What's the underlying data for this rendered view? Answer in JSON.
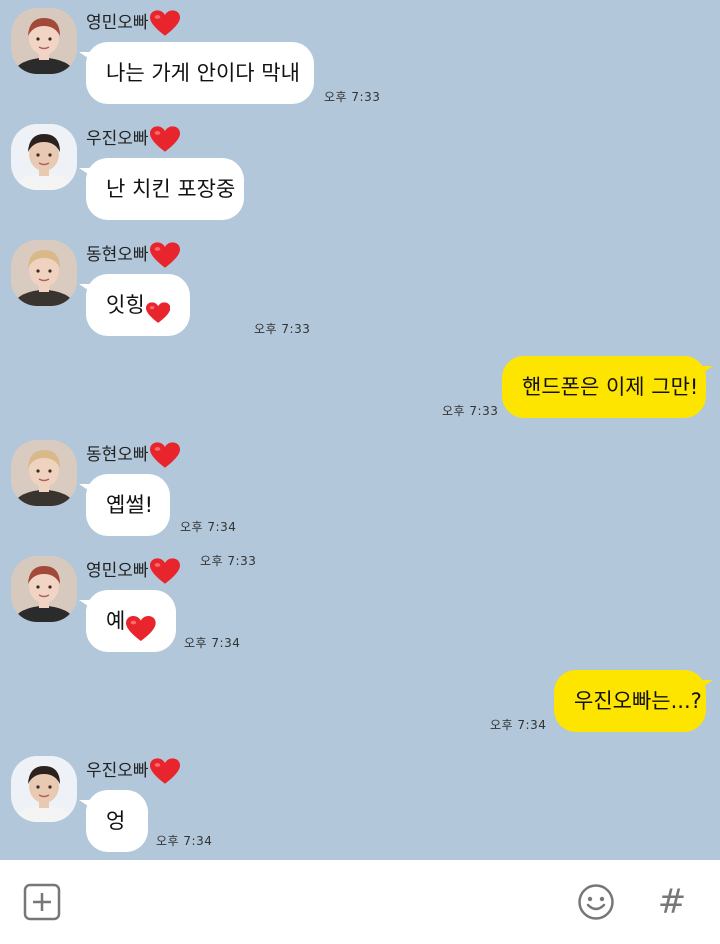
{
  "colors": {
    "background": "#b2c7da",
    "incoming_bubble": "#ffffff",
    "outgoing_bubble": "#fee500",
    "heart": "#e8252c"
  },
  "messages": [
    {
      "sender": "영민오빠",
      "text": "나는 가게 안이다 막내",
      "heart_in_text": false,
      "time": "오후 7:33",
      "direction": "in",
      "avatar": "avatar-youngmin"
    },
    {
      "sender": "우진오빠",
      "text": "난 치킨 포장중",
      "heart_in_text": false,
      "time": "오후 7:33",
      "direction": "in",
      "avatar": "avatar-woojin"
    },
    {
      "sender": "동현오빠",
      "text": "잇힝",
      "heart_in_text": true,
      "time": "오후 7:33",
      "direction": "in",
      "avatar": "avatar-donghyun"
    },
    {
      "sender": "",
      "text": "핸드폰은 이제 그만!",
      "heart_in_text": false,
      "time": "오후 7:33",
      "direction": "out",
      "avatar": ""
    },
    {
      "sender": "동현오빠",
      "text": "옙썰!",
      "heart_in_text": false,
      "time": "오후 7:34",
      "direction": "in",
      "avatar": "avatar-donghyun"
    },
    {
      "sender": "영민오빠",
      "text": "예",
      "heart_in_text": true,
      "time": "오후 7:34",
      "direction": "in",
      "avatar": "avatar-youngmin"
    },
    {
      "sender": "",
      "text": "우진오빠는...?",
      "heart_in_text": false,
      "time": "오후 7:34",
      "direction": "out",
      "avatar": ""
    },
    {
      "sender": "우진오빠",
      "text": "엉",
      "heart_in_text": false,
      "time": "오후 7:34",
      "direction": "in",
      "avatar": "avatar-woojin"
    }
  ],
  "input_bar": {
    "add_icon": "plus-square-icon",
    "emoji_icon": "smiley-icon",
    "hash_label": "#"
  }
}
